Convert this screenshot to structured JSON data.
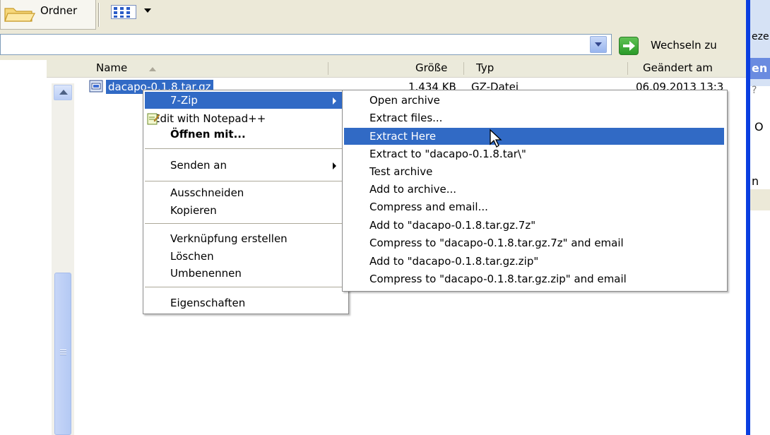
{
  "toolbar": {
    "folders_label": "Ordner",
    "views_icon": "views-icon"
  },
  "address_bar": {
    "go_label": "Wechseln zu"
  },
  "list_header": {
    "close": "✕",
    "name": "Name",
    "size": "Größe",
    "type": "Typ",
    "modified": "Geändert am"
  },
  "file": {
    "name": "dacapo-0.1.8.tar.gz",
    "size": "1.434 KB",
    "type": "GZ-Datei",
    "modified": "06.09.2013 13:3"
  },
  "context_menu": {
    "items": [
      "7-Zip",
      "Edit with Notepad++",
      "Öffnen mit...",
      "Senden an",
      "Ausschneiden",
      "Kopieren",
      "Verknüpfung erstellen",
      "Löschen",
      "Umbenennen",
      "Eigenschaften"
    ]
  },
  "seven_zip_menu": {
    "items": [
      "Open archive",
      "Extract files...",
      "Extract Here",
      "Extract to \"dacapo-0.1.8.tar\\\"",
      "Test archive",
      "Add to archive...",
      "Compress and email...",
      "Add to \"dacapo-0.1.8.tar.gz.7z\"",
      "Compress to \"dacapo-0.1.8.tar.gz.7z\" and email",
      "Add to \"dacapo-0.1.8.tar.gz.zip\"",
      "Compress to \"dacapo-0.1.8.tar.gz.zip\" and email"
    ],
    "highlighted": "Extract Here"
  },
  "right_window": {
    "fragment_top": "eze",
    "fragment_caption": "en",
    "fragment_q": "?",
    "fragment_o": "O",
    "fragment_n": "n"
  },
  "colors": {
    "selection": "#316ac5",
    "xp_blue": "#0a3ee0",
    "toolbar_bg": "#ece9d8"
  }
}
